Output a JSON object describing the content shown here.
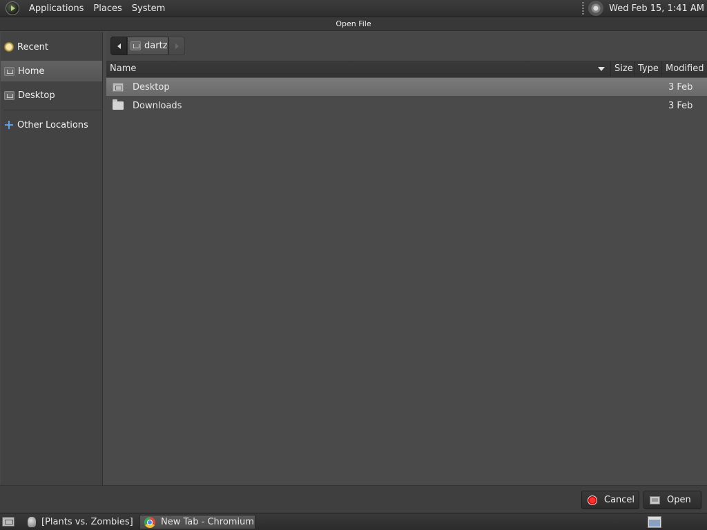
{
  "top_panel": {
    "menus": [
      "Applications",
      "Places",
      "System"
    ],
    "clock": "Wed Feb 15,  1:41 AM"
  },
  "dialog": {
    "title": "Open File"
  },
  "sidebar": {
    "items": [
      {
        "label": "Recent",
        "icon": "recent-icon"
      },
      {
        "label": "Home",
        "icon": "home-icon",
        "selected": true
      },
      {
        "label": "Desktop",
        "icon": "desktop-icon"
      },
      {
        "label": "Other Locations",
        "icon": "plus-icon"
      }
    ]
  },
  "path_bar": {
    "crumb": "dartz"
  },
  "file_list": {
    "columns": [
      "Name",
      "Size",
      "Type",
      "Modified"
    ],
    "rows": [
      {
        "name": "Desktop",
        "size": "",
        "type": "",
        "modified": "3 Feb",
        "selected": true
      },
      {
        "name": "Downloads",
        "size": "",
        "type": "",
        "modified": "3 Feb",
        "selected": false
      }
    ]
  },
  "buttons": {
    "cancel": "Cancel",
    "open": "Open"
  },
  "taskbar": {
    "tasks": [
      {
        "label": "[Plants vs. Zombies]",
        "icon": "zombie-icon"
      },
      {
        "label": "New Tab - Chromium",
        "icon": "chromium-icon",
        "active": true
      }
    ]
  },
  "colors": {
    "background": "#4a4a4a",
    "selection": "#6e6e6e",
    "cancel_icon": "#e00000"
  }
}
